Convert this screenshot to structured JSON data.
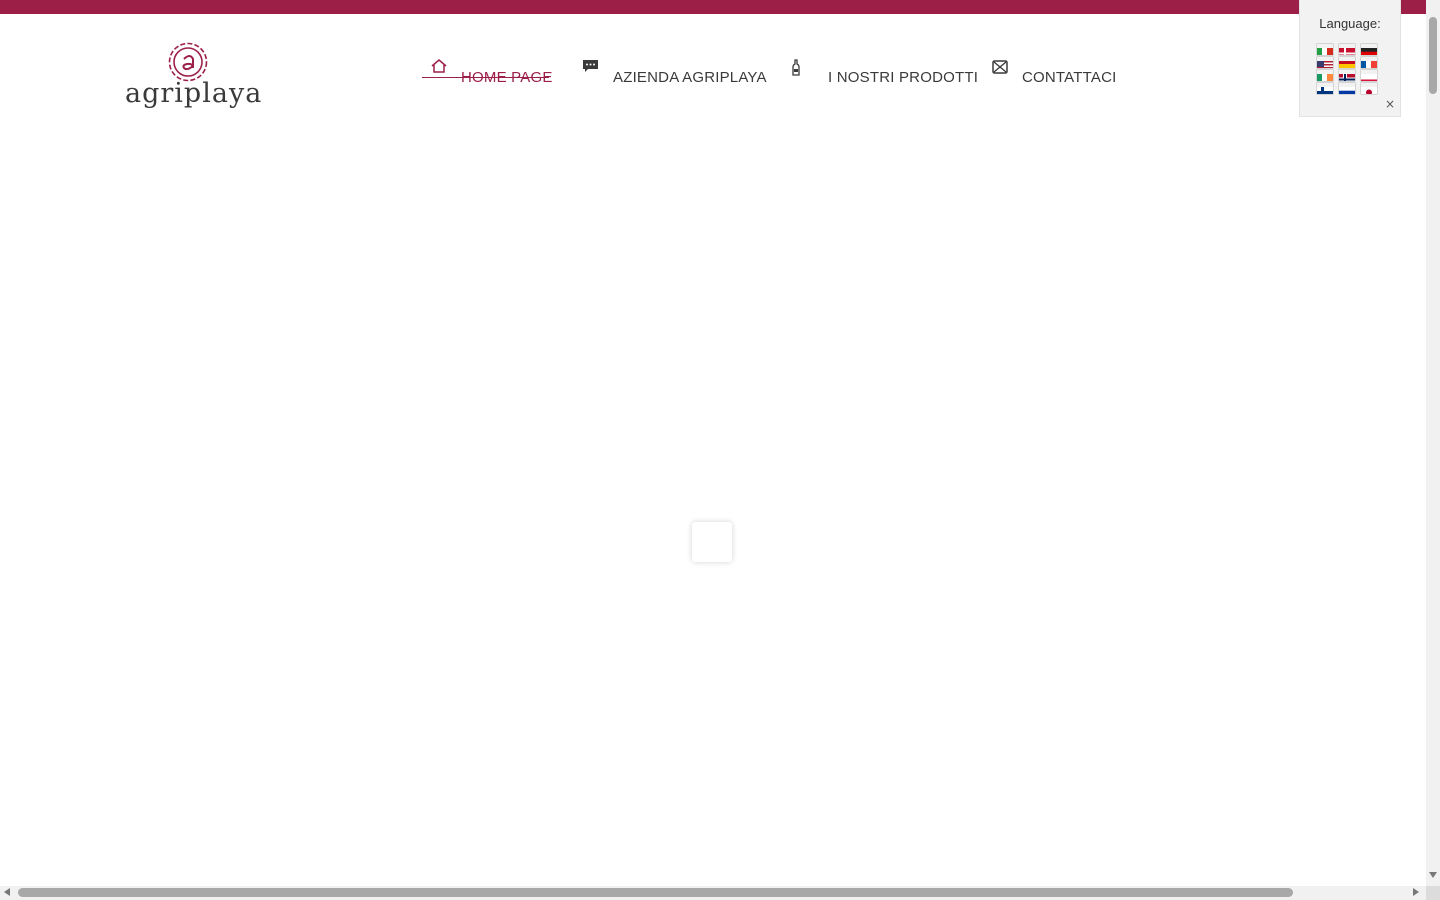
{
  "colors": {
    "brand": "#9c1f48",
    "text": "#3a3a3a",
    "background": "#ffffff"
  },
  "logo": {
    "text": "agriplaya",
    "monogram": "a"
  },
  "nav": {
    "items": [
      {
        "label": "HOME PAGE",
        "icon": "home-icon",
        "active": true
      },
      {
        "label": "AZIENDA AGRIPLAYA",
        "icon": "chat-icon",
        "active": false
      },
      {
        "label": "I NOSTRI PRODOTTI",
        "icon": "bottle-icon",
        "active": false
      },
      {
        "label": "CONTATTACI",
        "icon": "envelope-icon",
        "active": false
      }
    ]
  },
  "language_panel": {
    "title": "Language:",
    "close_label": "×",
    "flags": [
      "it",
      "dk",
      "de",
      "us",
      "es",
      "fr",
      "ie",
      "no",
      "pl",
      "fi",
      "ru",
      "jp"
    ]
  }
}
